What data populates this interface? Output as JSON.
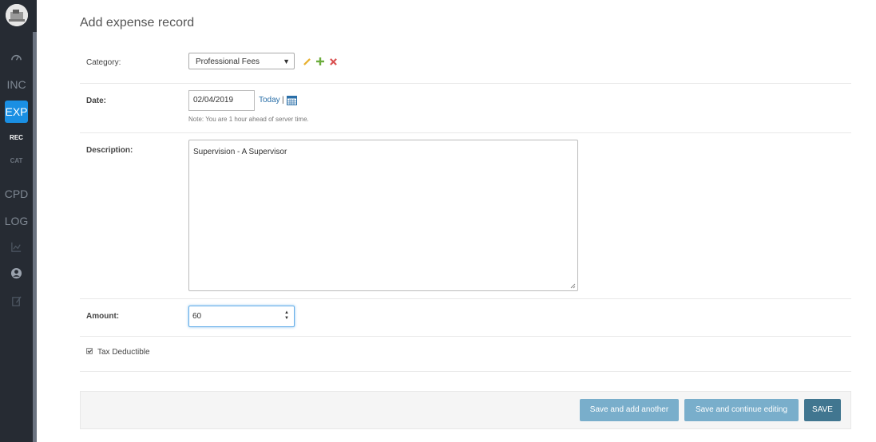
{
  "sidebar": {
    "items": [
      {
        "label": "INC"
      },
      {
        "label": "EXP"
      },
      {
        "label": "REC"
      },
      {
        "label": "CAT"
      },
      {
        "label": "CPD"
      },
      {
        "label": "LOG"
      }
    ],
    "icons": [
      "dashboard-icon",
      "chart-icon",
      "user-icon",
      "notes-icon"
    ],
    "active_color": "#1a8fe3"
  },
  "form": {
    "title": "Add expense record",
    "category_label": "Category:",
    "category_value": "Professional Fees",
    "date_label": "Date:",
    "date_value": "02/04/2019",
    "today_link": "Today",
    "date_separator": "|",
    "date_note": "Note: You are 1 hour ahead of server time.",
    "description_label": "Description:",
    "description_value": "Supervision - A Supervisor",
    "amount_label": "Amount:",
    "amount_value": "60",
    "tax_label": "Tax Deductible",
    "tax_checked": true
  },
  "actions": {
    "save_add_another": "Save and add another",
    "save_continue": "Save and continue editing",
    "save": "SAVE"
  }
}
